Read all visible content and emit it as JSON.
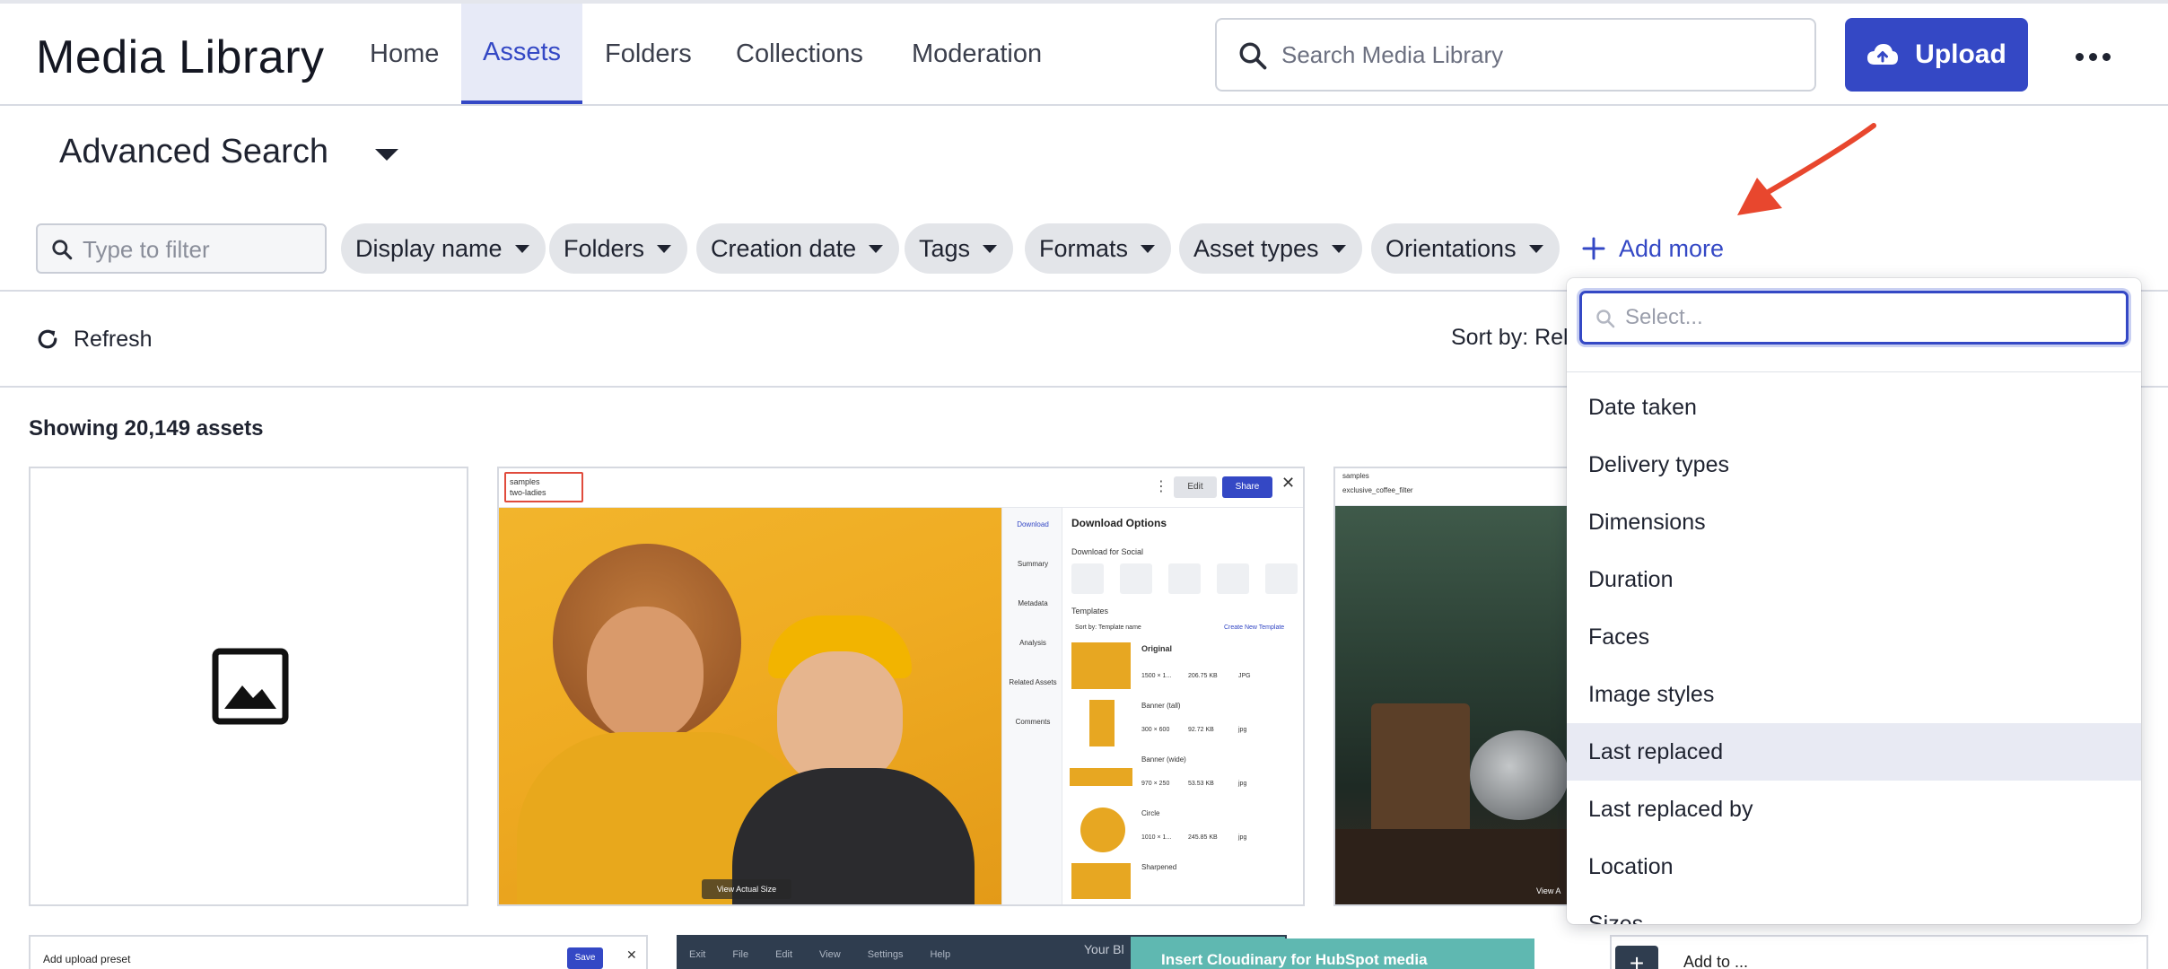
{
  "header": {
    "app_title": "Media Library",
    "nav": [
      {
        "label": "Home",
        "active": false
      },
      {
        "label": "Assets",
        "active": true
      },
      {
        "label": "Folders",
        "active": false
      },
      {
        "label": "Collections",
        "active": false
      },
      {
        "label": "Moderation",
        "active": false
      }
    ],
    "search": {
      "placeholder": "Search Media Library",
      "value": ""
    },
    "upload_label": "Upload",
    "accent_color": "#3448c5"
  },
  "advanced_search": {
    "title": "Advanced Search",
    "filter_placeholder": "Type to filter",
    "chips": [
      "Display name",
      "Folders",
      "Creation date",
      "Tags",
      "Formats",
      "Asset types",
      "Orientations"
    ],
    "add_more_label": "Add more"
  },
  "toolbar": {
    "refresh_label": "Refresh",
    "sort_label": "Sort by: Rel"
  },
  "results": {
    "showing_text": "Showing 20,149 assets"
  },
  "cards": {
    "card2": {
      "folder": "samples",
      "name": "two-ladies",
      "edit": "Edit",
      "share": "Share",
      "side_tabs": [
        "Download",
        "Summary",
        "Metadata",
        "Analysis",
        "Related Assets",
        "Comments"
      ],
      "panel_title": "Download Options",
      "social_title": "Download for Social",
      "templates_title": "Templates",
      "sort_template": "Sort by: Template name",
      "create_template": "Create New Template",
      "templates": [
        {
          "name": "Original",
          "dims": "1500 × 1...",
          "size": "206.75 KB",
          "fmt": "JPG"
        },
        {
          "name": "Banner (tall)",
          "dims": "300 × 600",
          "size": "92.72 KB",
          "fmt": "jpg"
        },
        {
          "name": "Banner (wide)",
          "dims": "970 × 250",
          "size": "53.53 KB",
          "fmt": "jpg"
        },
        {
          "name": "Circle",
          "dims": "1010 × 1...",
          "size": "245.85 KB",
          "fmt": "jpg"
        },
        {
          "name": "Sharpened",
          "dims": "",
          "size": "",
          "fmt": ""
        }
      ],
      "view_actual": "View Actual Size"
    },
    "card3": {
      "folder": "samples",
      "name": "exclusive_coffee_filter",
      "view_actual": "View A"
    },
    "card4": {
      "title": "Add upload preset",
      "save": "Save"
    },
    "card5": {
      "menu": [
        "Exit",
        "File",
        "Edit",
        "View",
        "Settings",
        "Help"
      ],
      "banner": "Insert Cloudinary for HubSpot media",
      "tail": "Your Bl"
    },
    "card6": {
      "title": "Add to ..."
    }
  },
  "dropdown": {
    "search_placeholder": "Select...",
    "items": [
      {
        "label": "Date taken",
        "highlighted": false
      },
      {
        "label": "Delivery types",
        "highlighted": false
      },
      {
        "label": "Dimensions",
        "highlighted": false
      },
      {
        "label": "Duration",
        "highlighted": false
      },
      {
        "label": "Faces",
        "highlighted": false
      },
      {
        "label": "Image styles",
        "highlighted": false
      },
      {
        "label": "Last replaced",
        "highlighted": true
      },
      {
        "label": "Last replaced by",
        "highlighted": false
      },
      {
        "label": "Location",
        "highlighted": false
      },
      {
        "label": "Sizes",
        "highlighted": false
      }
    ]
  },
  "annotation_color": "#e8472e"
}
